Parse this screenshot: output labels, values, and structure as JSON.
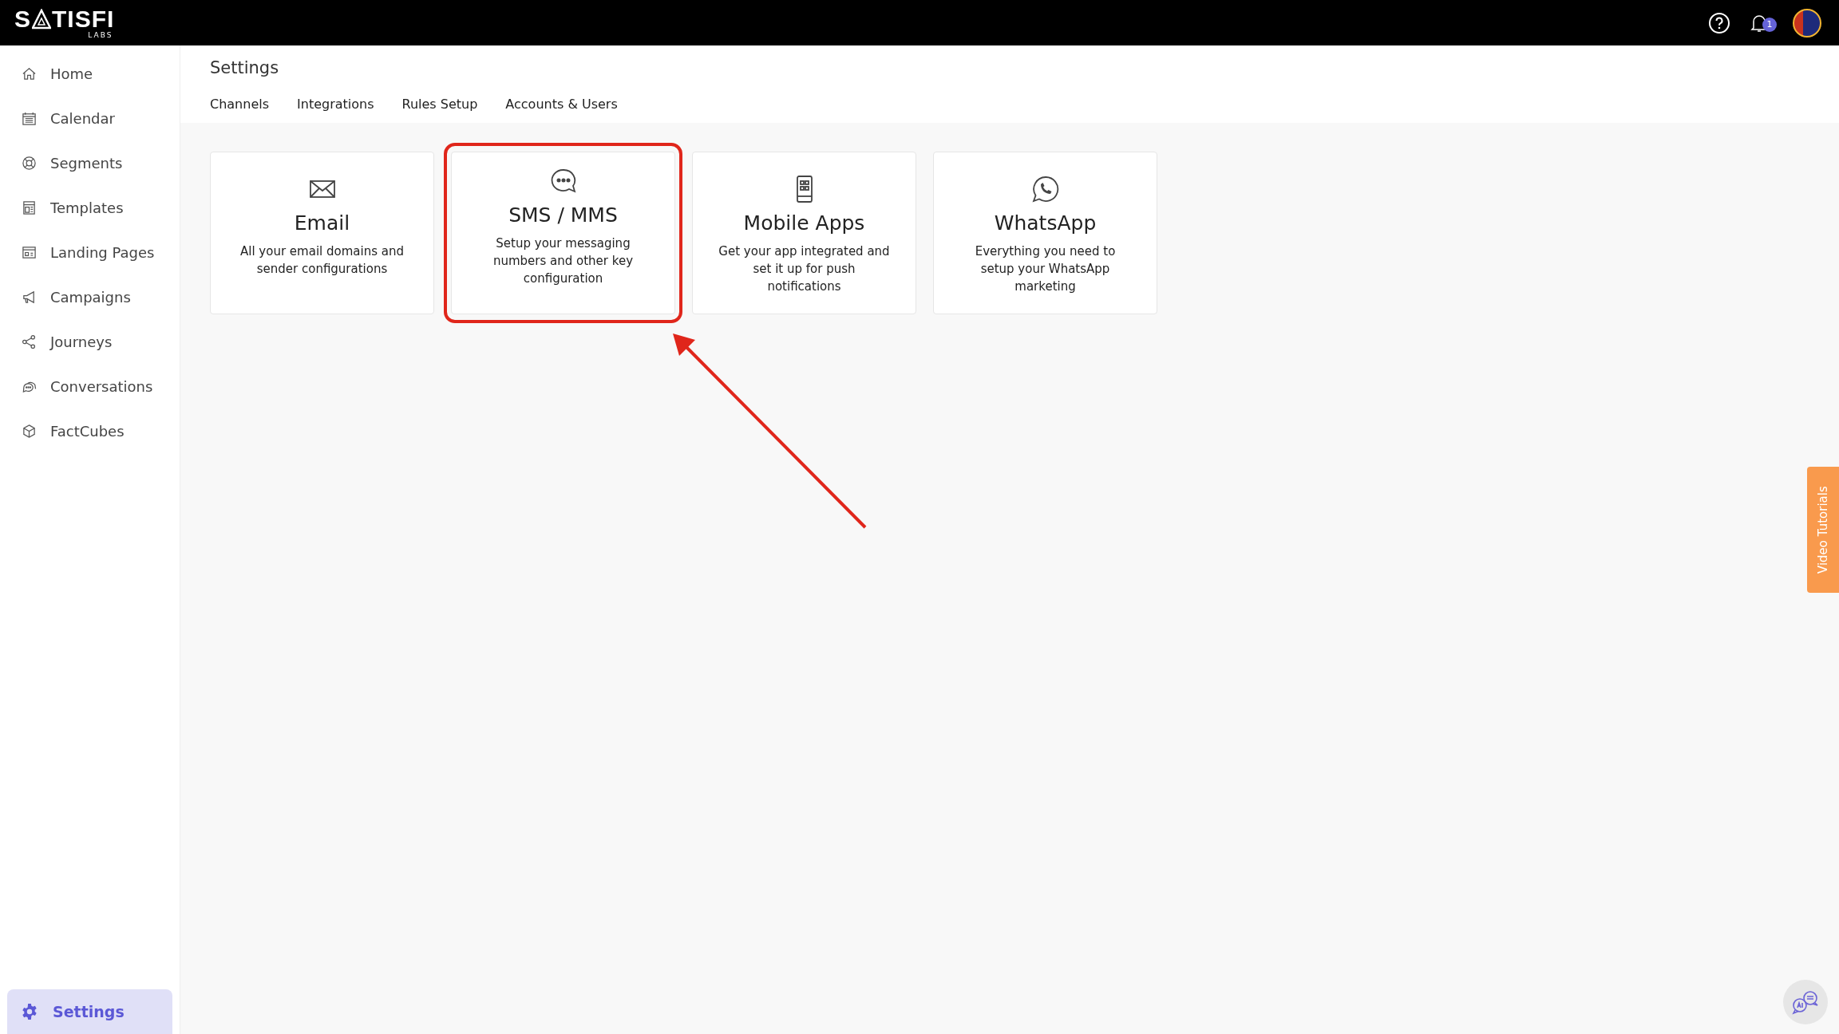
{
  "logo": {
    "before": "S",
    "after": "TISFI",
    "sub": "LABS"
  },
  "header": {
    "notification_count": "1"
  },
  "sidebar": {
    "items": [
      {
        "label": "Home",
        "kind": "home",
        "selected": false
      },
      {
        "label": "Calendar",
        "kind": "calendar",
        "selected": false
      },
      {
        "label": "Segments",
        "kind": "segments",
        "selected": false
      },
      {
        "label": "Templates",
        "kind": "templates",
        "selected": false
      },
      {
        "label": "Landing Pages",
        "kind": "landing",
        "selected": false
      },
      {
        "label": "Campaigns",
        "kind": "megaphone",
        "selected": false
      },
      {
        "label": "Journeys",
        "kind": "share",
        "selected": false
      },
      {
        "label": "Conversations",
        "kind": "chat",
        "selected": false
      },
      {
        "label": "FactCubes",
        "kind": "cube",
        "selected": false
      }
    ],
    "bottom_item": {
      "label": "Settings",
      "selected": true
    }
  },
  "page": {
    "title": "Settings",
    "tabs": [
      {
        "label": "Channels"
      },
      {
        "label": "Integrations"
      },
      {
        "label": "Rules Setup"
      },
      {
        "label": "Accounts & Users"
      }
    ],
    "cards": [
      {
        "kind": "mail",
        "title": "Email",
        "description": "All your email domains and sender configurations",
        "highlighted": false
      },
      {
        "kind": "chat",
        "title": "SMS / MMS",
        "description": "Setup your messaging numbers and other key configuration",
        "highlighted": true
      },
      {
        "kind": "phone",
        "title": "Mobile Apps",
        "description": "Get your app integrated and set it up for push notifications",
        "highlighted": false
      },
      {
        "kind": "whatsapp",
        "title": "WhatsApp",
        "description": "Everything you need to setup your WhatsApp marketing",
        "highlighted": false
      }
    ]
  },
  "video_tutorials_tab": "Video Tutorials"
}
